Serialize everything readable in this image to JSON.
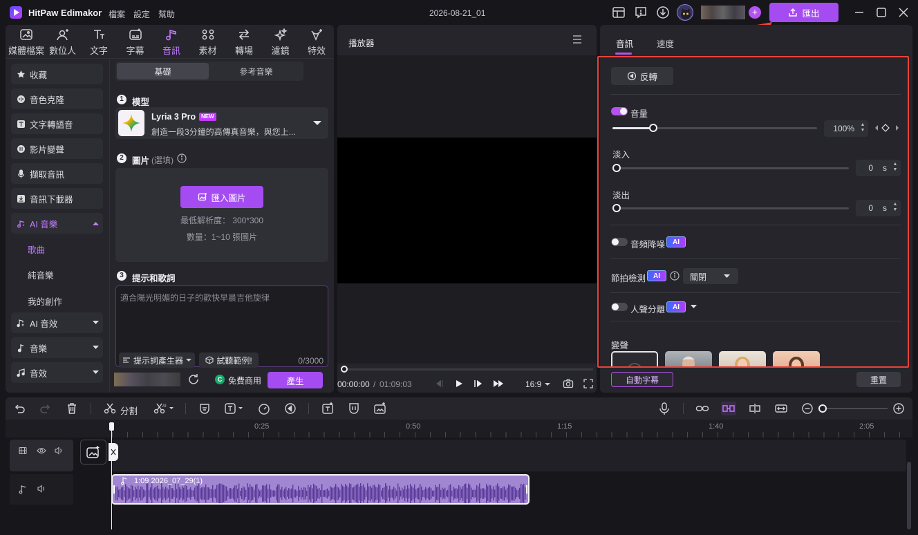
{
  "app": {
    "name": "HitPaw Edimakor",
    "project_title": "2026-08-21_01",
    "menu": [
      "檔案",
      "設定",
      "幫助"
    ],
    "export_label": "匯出"
  },
  "nav": {
    "tabs": [
      {
        "label": "媒體檔案",
        "icon": "media-icon"
      },
      {
        "label": "數位人",
        "icon": "avatar-person-icon"
      },
      {
        "label": "文字",
        "icon": "text-icon"
      },
      {
        "label": "字幕",
        "icon": "subtitle-icon"
      },
      {
        "label": "音訊",
        "icon": "music-icon"
      },
      {
        "label": "素材",
        "icon": "stickers-icon"
      },
      {
        "label": "轉場",
        "icon": "transition-icon"
      },
      {
        "label": "濾鏡",
        "icon": "filter-icon"
      },
      {
        "label": "特效",
        "icon": "effects-icon"
      }
    ],
    "active": "音訊"
  },
  "sidebar": {
    "items": [
      {
        "label": "收藏",
        "icon": "star-icon"
      },
      {
        "label": "音色克隆",
        "icon": "voice-clone-icon"
      },
      {
        "label": "文字轉語音",
        "icon": "text-to-speech-icon"
      },
      {
        "label": "影片變聲",
        "icon": "voice-changer-icon"
      },
      {
        "label": "擷取音訊",
        "icon": "microphone-icon"
      },
      {
        "label": "音訊下載器",
        "icon": "download-icon"
      },
      {
        "label": "AI 音樂",
        "icon": "ai-music-icon"
      },
      {
        "label": "AI 音效",
        "icon": "ai-sfx-icon"
      },
      {
        "label": "音樂",
        "icon": "note-icon"
      },
      {
        "label": "音效",
        "icon": "sfx-icon"
      }
    ],
    "ai_music_sub": [
      "歌曲",
      "純音樂",
      "我的創作"
    ]
  },
  "music_gen": {
    "tabs": [
      "基礎",
      "參考音樂"
    ],
    "step1_title": "模型",
    "model_name": "Lyria 3 Pro",
    "model_badge": "NEW",
    "model_desc": "創造一段3分鐘的高傳真音樂，與您上...",
    "step2_title": "圖片",
    "step2_optional": "(選填)",
    "import_label": "匯入圖片",
    "min_res": "最低解析度： 300*300",
    "count": "數量：1~10 張圖片",
    "step3_title": "提示和歌詞",
    "prompt_placeholder": "適合陽光明媚的日子的歡快早晨吉他旋律",
    "prompt_gen_label": "提示詞產生器",
    "sample_label": "試聽範例!",
    "char_count": "0/3000",
    "free_label": "免費商用",
    "generate_label": "產生"
  },
  "player": {
    "title": "播放器",
    "current_time": "00:00:00",
    "total_time": "01:09:03",
    "aspect": "16:9"
  },
  "properties": {
    "tabs": [
      "音訊",
      "速度"
    ],
    "active_tab": "音訊",
    "reverse_label": "反轉",
    "volume_label": "音量",
    "volume_value": "100%",
    "volume_level": 0.2,
    "fade_in_label": "淡入",
    "fade_in_value": "0",
    "fade_out_label": "淡出",
    "fade_out_value": "0",
    "unit_s": "s",
    "denoise_label": "音頻降噪",
    "beat_label": "節拍檢測",
    "beat_value": "關閉",
    "vocal_label": "人聲分離",
    "voice_change_label": "變聲",
    "ai_badge": "AI",
    "auto_subtitle_label": "自動字幕",
    "reset_label": "重置"
  },
  "timeline": {
    "tools": {
      "split_label": "分割"
    },
    "ruler": [
      "0:25",
      "0:50",
      "1:15",
      "1:40",
      "2:05"
    ],
    "clip_label": "1:09 2026_07_29(1)"
  },
  "colors": {
    "accent": "#b453f0",
    "highlight_border": "#e5443a",
    "clip_fill": "#7b52b8"
  }
}
